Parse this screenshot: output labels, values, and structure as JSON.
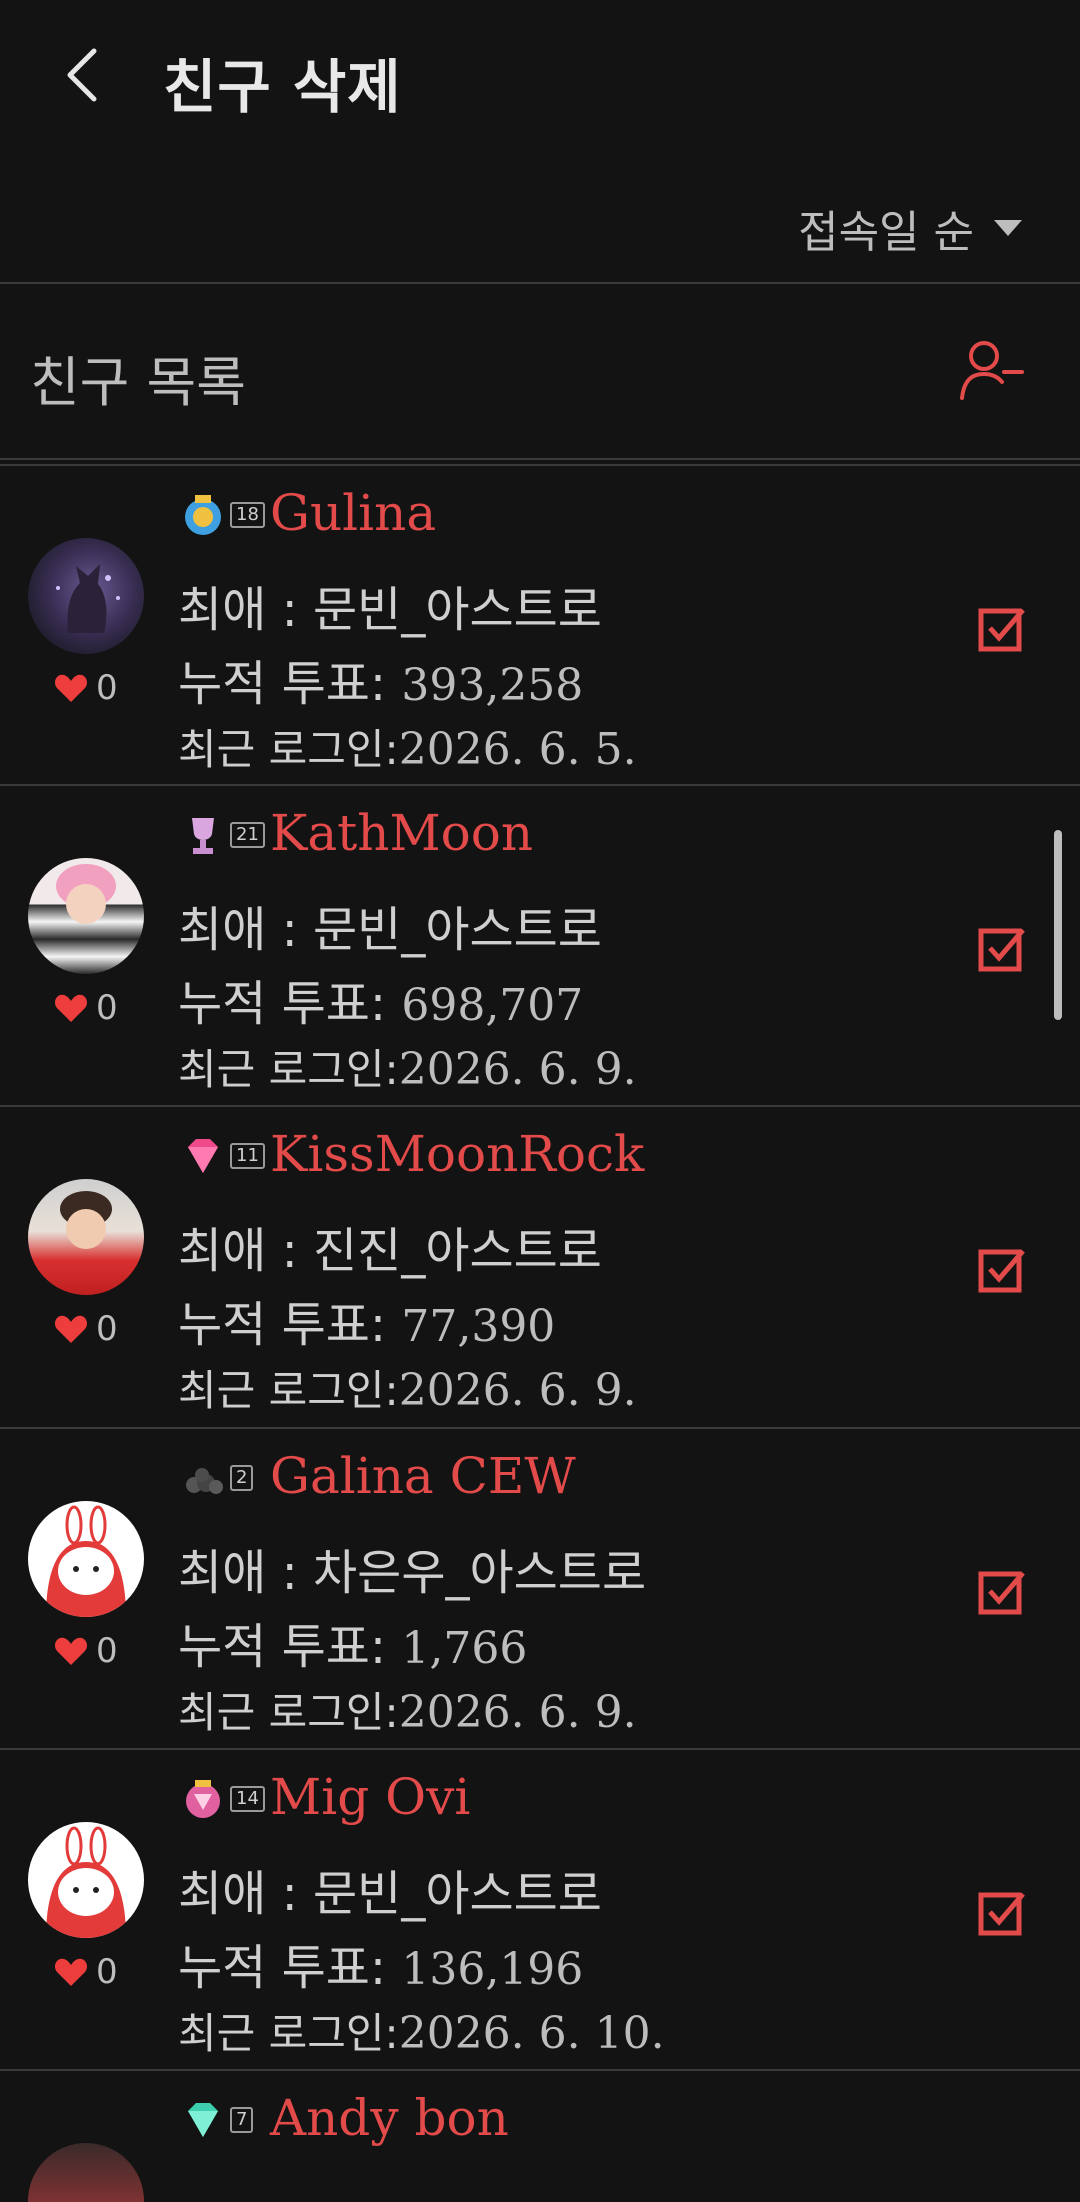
{
  "header": {
    "title": "친구 삭제"
  },
  "sort": {
    "label": "접속일 순"
  },
  "list": {
    "title": "친구 목록"
  },
  "friends": [
    {
      "name": "Gulina",
      "level": "18",
      "favorite": "최애 : 문빈_아스트로",
      "votes_label": "누적 투표:",
      "votes": "393,258",
      "login_label": "최근 로그인:",
      "login": "2026. 6. 5.",
      "likes": "0",
      "badge": "crest"
    },
    {
      "name": "KathMoon",
      "level": "21",
      "favorite": "최애 : 문빈_아스트로",
      "votes_label": "누적 투표:",
      "votes": "698,707",
      "login_label": "최근 로그인:",
      "login": "2026. 6. 9.",
      "likes": "0",
      "badge": "trophy"
    },
    {
      "name": "KissMoonRock",
      "level": "11",
      "favorite": "최애 : 진진_아스트로",
      "votes_label": "누적 투표:",
      "votes": "77,390",
      "login_label": "최근 로그인:",
      "login": "2026. 6. 9.",
      "likes": "0",
      "badge": "pink-diamond"
    },
    {
      "name": "Galina CEW",
      "level": "2",
      "favorite": "최애 : 차은우_아스트로",
      "votes_label": "누적 투표:",
      "votes": "1,766",
      "login_label": "최근 로그인:",
      "login": "2026. 6. 9.",
      "likes": "0",
      "badge": "coal"
    },
    {
      "name": "Mig Ovi",
      "level": "14",
      "favorite": "최애 : 문빈_아스트로",
      "votes_label": "누적 투표:",
      "votes": "136,196",
      "login_label": "최근 로그인:",
      "login": "2026. 6. 10.",
      "likes": "0",
      "badge": "pink-crest"
    },
    {
      "name": "Andy bon",
      "level": "7",
      "badge": "teal-diamond"
    }
  ],
  "colors": {
    "accent": "#e34a4a",
    "background": "#131313"
  }
}
